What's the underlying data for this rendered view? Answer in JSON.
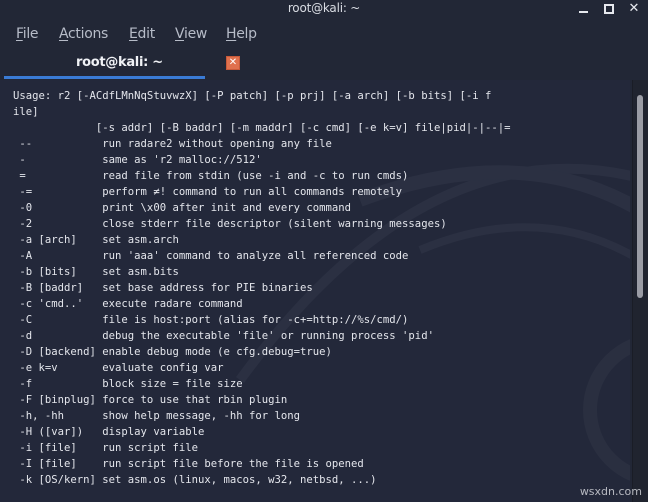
{
  "window": {
    "title": "root@kali: ~",
    "controls": {
      "minimize_icon": "minimize-icon",
      "maximize_icon": "maximize-icon",
      "close_glyph": "✕"
    }
  },
  "menubar": {
    "items": [
      {
        "label_mn": "F",
        "label_rest": "ile"
      },
      {
        "label_mn": "A",
        "label_rest": "ctions"
      },
      {
        "label_mn": "E",
        "label_rest": "dit"
      },
      {
        "label_mn": "V",
        "label_rest": "iew"
      },
      {
        "label_mn": "H",
        "label_rest": "elp"
      }
    ]
  },
  "tabs": [
    {
      "label": "root@kali: ~",
      "active": true,
      "close_glyph": "✕"
    }
  ],
  "colors": {
    "background": "#23283a",
    "accent": "#3a7bd5",
    "tab_close": "#e0714e",
    "text": "#e4e6ec"
  },
  "terminal": {
    "lines": [
      "Usage: r2 [-ACdfLMnNqStuvwzX] [-P patch] [-p prj] [-a arch] [-b bits] [-i f",
      "ile]",
      "             [-s addr] [-B baddr] [-m maddr] [-c cmd] [-e k=v] file|pid|-|--|=",
      " --           run radare2 without opening any file",
      " -            same as 'r2 malloc://512'",
      " =            read file from stdin (use -i and -c to run cmds)",
      " -=           perform ≠! command to run all commands remotely",
      " -0           print \\x00 after init and every command",
      " -2           close stderr file descriptor (silent warning messages)",
      " -a [arch]    set asm.arch",
      " -A           run 'aaa' command to analyze all referenced code",
      " -b [bits]    set asm.bits",
      " -B [baddr]   set base address for PIE binaries",
      " -c 'cmd..'   execute radare command",
      " -C           file is host:port (alias for -c+=http://%s/cmd/)",
      " -d           debug the executable 'file' or running process 'pid'",
      " -D [backend] enable debug mode (e cfg.debug=true)",
      " -e k=v       evaluate config var",
      " -f           block size = file size",
      " -F [binplug] force to use that rbin plugin",
      " -h, -hh      show help message, -hh for long",
      " -H ([var])   display variable",
      " -i [file]    run script file",
      " -I [file]    run script file before the file is opened",
      " -k [OS/kern] set asm.os (linux, macos, w32, netbsd, ...)"
    ]
  },
  "scrollbar": {
    "thumb_start_fraction": 0.035,
    "thumb_size_fraction": 0.48
  },
  "watermark_text": "wsxdn.com"
}
